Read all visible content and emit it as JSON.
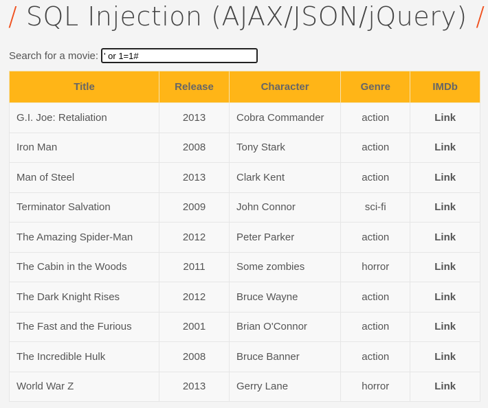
{
  "header": {
    "title": "SQL Injection (AJAX/JSON/jQuery)",
    "slash": "/"
  },
  "search": {
    "label": "Search for a movie:",
    "value": "' or 1=1#"
  },
  "table": {
    "columns": [
      "Title",
      "Release",
      "Character",
      "Genre",
      "IMDb"
    ],
    "rows": [
      [
        "G.I. Joe: Retaliation",
        "2013",
        "Cobra Commander",
        "action",
        "Link"
      ],
      [
        "Iron Man",
        "2008",
        "Tony Stark",
        "action",
        "Link"
      ],
      [
        "Man of Steel",
        "2013",
        "Clark Kent",
        "action",
        "Link"
      ],
      [
        "Terminator Salvation",
        "2009",
        "John Connor",
        "sci-fi",
        "Link"
      ],
      [
        "The Amazing Spider-Man",
        "2012",
        "Peter Parker",
        "action",
        "Link"
      ],
      [
        "The Cabin in the Woods",
        "2011",
        "Some zombies",
        "horror",
        "Link"
      ],
      [
        "The Dark Knight Rises",
        "2012",
        "Bruce Wayne",
        "action",
        "Link"
      ],
      [
        "The Fast and the Furious",
        "2001",
        "Brian O'Connor",
        "action",
        "Link"
      ],
      [
        "The Incredible Hulk",
        "2008",
        "Bruce Banner",
        "action",
        "Link"
      ],
      [
        "World War Z",
        "2013",
        "Gerry Lane",
        "horror",
        "Link"
      ]
    ]
  },
  "colors": {
    "accent": "#ffb517",
    "slash": "#f0501e"
  }
}
